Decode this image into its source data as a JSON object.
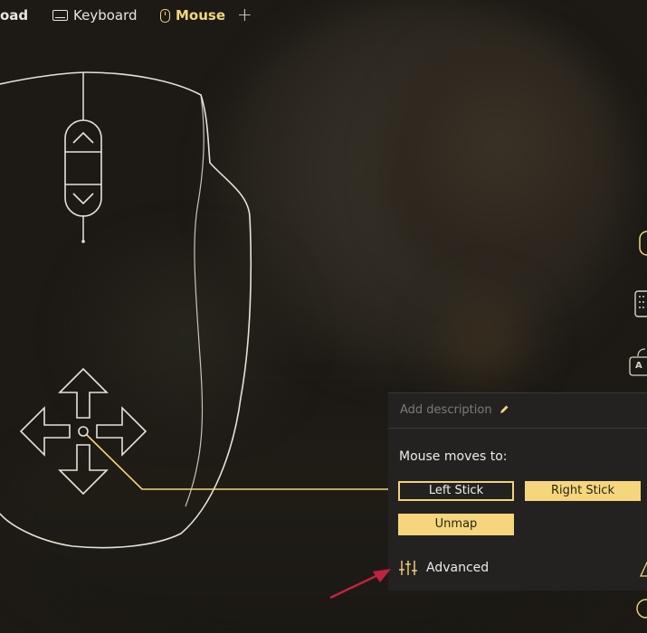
{
  "tabs": {
    "gamepad_label": "oad",
    "keyboard_label": "Keyboard",
    "mouse_label": "Mouse",
    "add_label": "+"
  },
  "panel": {
    "description_placeholder": "Add description",
    "moves_to_label": "Mouse moves to:",
    "left_stick_label": "Left Stick",
    "right_stick_label": "Right Stick",
    "unmap_label": "Unmap",
    "advanced_label": "Advanced"
  },
  "edge_icons": {
    "letter": "A"
  },
  "colors": {
    "accent": "#f6d67d",
    "selected_tab": "#f3d77a",
    "panel_bg": "#242221",
    "outline": "#e6e2d8",
    "annotation_arrow": "#c0233f"
  }
}
